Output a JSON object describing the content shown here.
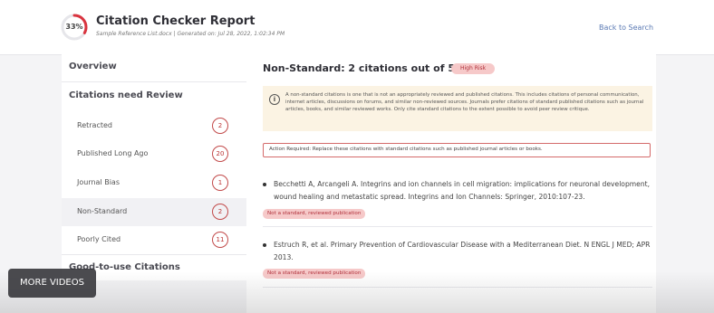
{
  "header": {
    "score": "33%",
    "score_fraction": 0.33,
    "title": "Citation Checker Report",
    "subtitle": "Sample Reference List.docx | Generated on: Jul 28, 2022, 1:02:34 PM",
    "back_link": "Back to Search"
  },
  "sidebar": {
    "overview": "Overview",
    "review_heading": "Citations need Review",
    "items": [
      {
        "label": "Retracted",
        "count": "2"
      },
      {
        "label": "Published Long Ago",
        "count": "20"
      },
      {
        "label": "Journal Bias",
        "count": "1"
      },
      {
        "label": "Non-Standard",
        "count": "2"
      },
      {
        "label": "Poorly Cited",
        "count": "11"
      }
    ],
    "good_heading": "Good-to-use Citations"
  },
  "main": {
    "title": "Non-Standard: 2 citations out of 54",
    "risk_badge": "High Risk",
    "info_text": "A non-standard citations is one that is not an appropriately reviewed and published citations. This includes citations of personal communication, internet articles, discussions on forums, and similar non-reviewed sources. Journals prefer citations of standard published citations such as journal articles, books, and similar reviewed works. Only cite standard citations to the extent possible to avoid peer review critique.",
    "action_required": "Action Required: Replace these citations with standard citations such as published journal articles or books.",
    "citations": [
      {
        "text": "Becchetti A, Arcangeli A. Integrins and ion channels in cell migration: implications for neuronal development, wound healing and metastatic spread. Integrins and Ion Channels: Springer, 2010:107-23.",
        "tag": "Not a standard, reviewed publication"
      },
      {
        "text": "Estruch R, et al. Primary Prevention of Cardiovascular Disease with a Mediterranean Diet. N ENGL J MED; APR 2013.",
        "tag": "Not a standard, reviewed publication"
      }
    ]
  },
  "overlay": {
    "more_videos": "MORE VIDEOS"
  },
  "colors": {
    "accent_red": "#d9343f",
    "link_blue": "#5a79b3",
    "badge_bg": "#f6c9c9",
    "info_bg": "#fbf3e3"
  }
}
